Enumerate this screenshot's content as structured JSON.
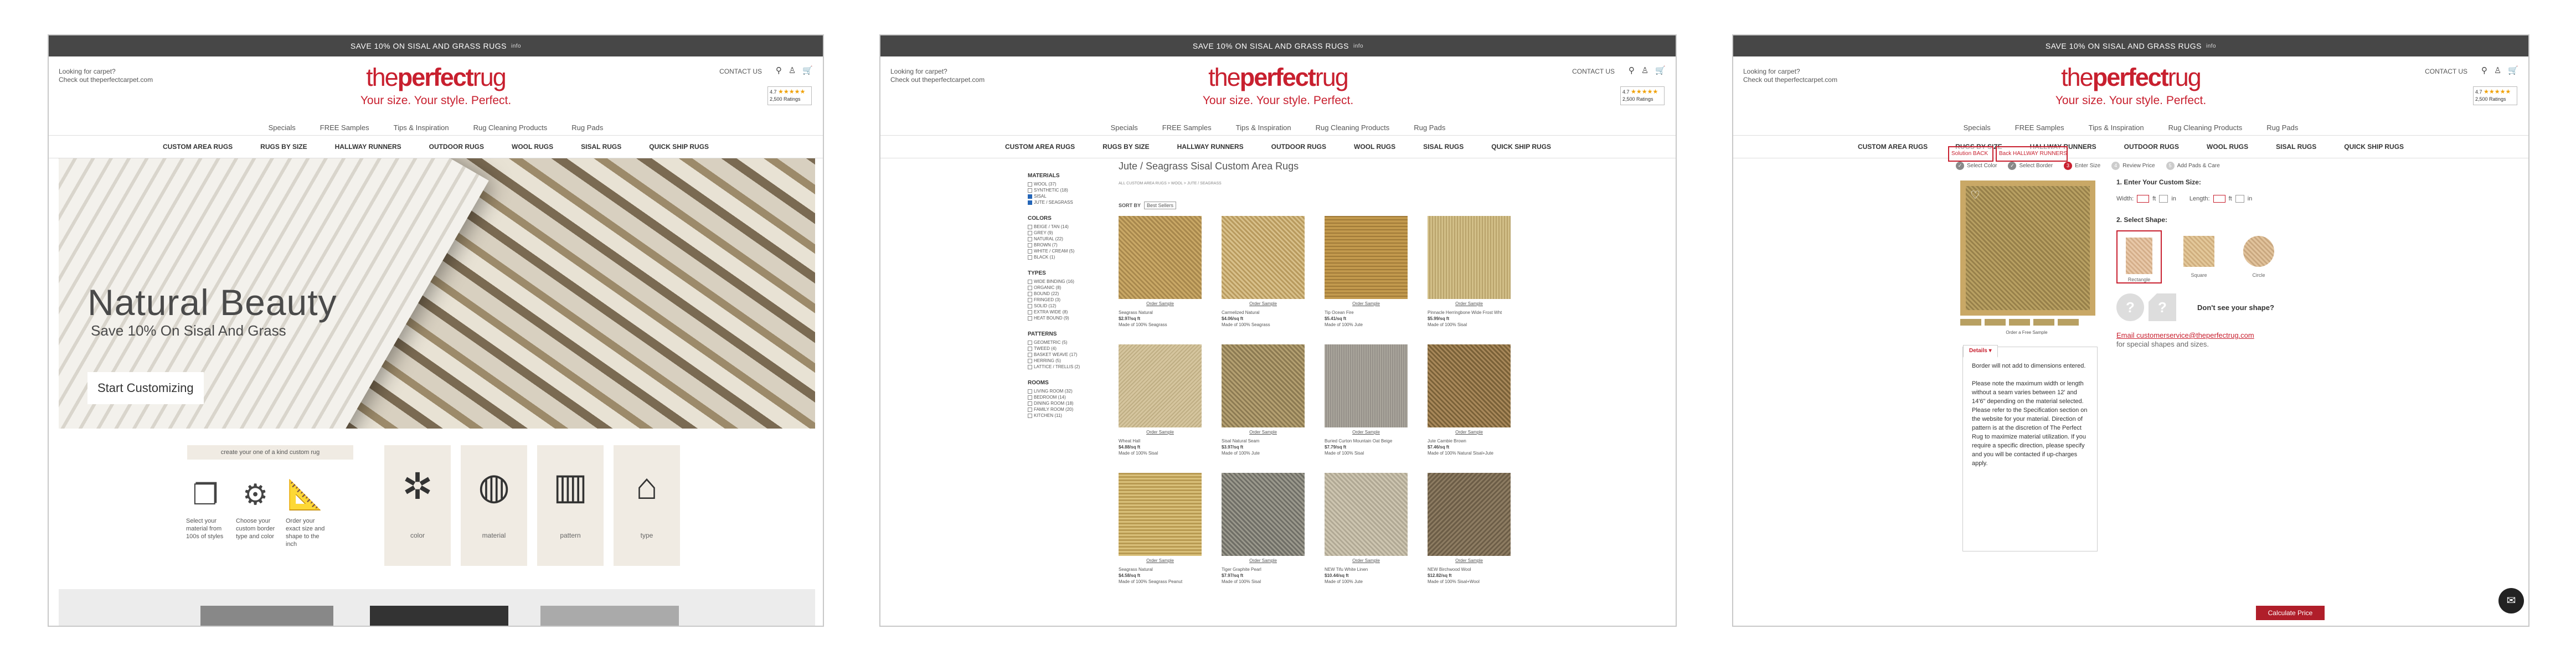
{
  "site": {
    "topbar": "SAVE 10% ON SISAL AND GRASS RUGS",
    "topbar_sub": "info",
    "looking": "Looking for carpet?",
    "checkout": "Check out theperfectcarpet.com",
    "logo_pre": "the",
    "logo_main": "perfect",
    "logo_end": "rug",
    "tagline": "Your size. Your style. Perfect.",
    "contact": "CONTACT US",
    "reviews_stars": "★★★★★",
    "reviews_label": "2,500 Ratings",
    "reviews_score": "4.7",
    "submenu": [
      "Specials",
      "FREE Samples",
      "Tips & Inspiration",
      "Rug Cleaning Products",
      "Rug Pads"
    ],
    "nav": [
      "CUSTOM AREA RUGS",
      "RUGS BY SIZE",
      "HALLWAY RUNNERS",
      "OUTDOOR RUGS",
      "WOOL RUGS",
      "SISAL RUGS",
      "QUICK SHIP RUGS"
    ]
  },
  "home": {
    "hero_title": "Natural Beauty",
    "hero_sub": "Save 10% On Sisal And Grass",
    "hero_btn": "Start Customizing",
    "create": "create your one of a kind custom rug",
    "steps": [
      {
        "icon": "❐",
        "text": "Select your material from 100s of styles"
      },
      {
        "icon": "⚙",
        "text": "Choose your custom border type and color"
      },
      {
        "icon": "📐",
        "text": "Order your exact size and shape to the inch"
      }
    ],
    "tiles": [
      {
        "icon": "✲",
        "label": "color"
      },
      {
        "icon": "◍",
        "label": "material"
      },
      {
        "icon": "▥",
        "label": "pattern"
      },
      {
        "icon": "⌂",
        "label": "type"
      }
    ]
  },
  "listing": {
    "title": "Jute / Seagrass Sisal Custom Area Rugs",
    "breadcrumb": "ALL CUSTOM AREA RUGS > WOOL > JUTE / SEAGRASS",
    "sort_label": "SORT BY",
    "sort_value": "Best Sellers",
    "filters": [
      {
        "name": "MATERIALS",
        "opts": [
          {
            "label": "WOOL (37)",
            "on": false
          },
          {
            "label": "SYNTHETIC (18)",
            "on": false
          },
          {
            "label": "SISAL",
            "on": true
          },
          {
            "label": "JUTE / SEAGRASS",
            "on": true
          }
        ]
      },
      {
        "name": "COLORS",
        "opts": [
          {
            "label": "BEIGE / TAN (14)",
            "on": false
          },
          {
            "label": "GREY (9)",
            "on": false
          },
          {
            "label": "NATURAL (22)",
            "on": false
          },
          {
            "label": "BROWN (7)",
            "on": false
          },
          {
            "label": "WHITE / CREAM (5)",
            "on": false
          },
          {
            "label": "BLACK (1)",
            "on": false
          }
        ]
      },
      {
        "name": "TYPES",
        "opts": [
          {
            "label": "WIDE BINDING (16)",
            "on": false
          },
          {
            "label": "ORGANIC (8)",
            "on": false
          },
          {
            "label": "BOUND (22)",
            "on": false
          },
          {
            "label": "FRINGED (3)",
            "on": false
          },
          {
            "label": "SOLID (12)",
            "on": false
          },
          {
            "label": "EXTRA WIDE (8)",
            "on": false
          },
          {
            "label": "HEAT BOUND (9)",
            "on": false
          }
        ]
      },
      {
        "name": "PATTERNS",
        "opts": [
          {
            "label": "GEOMETRIC (5)",
            "on": false
          },
          {
            "label": "TWEED (4)",
            "on": false
          },
          {
            "label": "BASKET WEAVE (17)",
            "on": false
          },
          {
            "label": "HERRING (5)",
            "on": false
          },
          {
            "label": "LATTICE / TRELLIS (2)",
            "on": false
          }
        ]
      },
      {
        "name": "ROOMS",
        "opts": [
          {
            "label": "LIVING ROOM (32)",
            "on": false
          },
          {
            "label": "BEDROOM (14)",
            "on": false
          },
          {
            "label": "DINING ROOM (18)",
            "on": false
          },
          {
            "label": "FAMILY ROOM (20)",
            "on": false
          },
          {
            "label": "KITCHEN (11)",
            "on": false
          }
        ]
      }
    ],
    "swatch_label": "Order Sample",
    "products": [
      {
        "name": "Seagrass Natural",
        "price": "$2.97/sq ft",
        "mat": "Made of 100% Seagrass"
      },
      {
        "name": "Carmelized Natural",
        "price": "$4.06/sq ft",
        "mat": "Made of 100% Seagrass"
      },
      {
        "name": "Tip Ocean Fire",
        "price": "$5.41/sq ft",
        "mat": "Made of 100% Jute"
      },
      {
        "name": "Pinnacle Herringbone Wide Frost Wht",
        "price": "$5.99/sq ft",
        "mat": "Made of 100% Sisal"
      },
      {
        "name": "Wheat Hall",
        "price": "$4.88/sq ft",
        "mat": "Made of 100% Sisal"
      },
      {
        "name": "Sisal Natural Seam",
        "price": "$3.97/sq ft",
        "mat": "Made of 100% Jute"
      },
      {
        "name": "Buried Curton Mountain Oat Beige",
        "price": "$7.79/sq ft",
        "mat": "Made of 100% Sisal"
      },
      {
        "name": "Jute Cambie Brown",
        "price": "$7.46/sq ft",
        "mat": "Made of 100% Natural Sisal+Jute"
      },
      {
        "name": "Seagrass Natural",
        "price": "$4.58/sq ft",
        "mat": "Made of 100% Seagrass Peanut"
      },
      {
        "name": "Tiger Graphite Pearl",
        "price": "$7.97/sq ft",
        "mat": "Made of 100% Sisal"
      },
      {
        "name": "NEW Tifu White Linen",
        "price": "$10.44/sq ft",
        "mat": "Made of 100% Jute"
      },
      {
        "name": "NEW Birchwood Wool",
        "price": "$12.82/sq ft",
        "mat": "Made of 100% Sisal+Wool"
      }
    ]
  },
  "configurator": {
    "overlay1": "Solution BACK",
    "overlay2": "Back HALLWAY RUNNERS",
    "steps": [
      {
        "n": "✓",
        "label": "Select Color",
        "state": "done"
      },
      {
        "n": "✓",
        "label": "Select Border",
        "state": "done"
      },
      {
        "n": "3",
        "label": "Enter Size",
        "state": "act"
      },
      {
        "n": "4",
        "label": "Review Price",
        "state": "off"
      },
      {
        "n": "5",
        "label": "Add Pads & Care",
        "state": "off"
      }
    ],
    "free_sample": "Order a Free Sample",
    "details_tab": "Details ▾",
    "details": [
      "Border will not add to dimensions entered.",
      "Please note the maximum width or length without a seam varies between 12' and 14'6\" depending on the material selected. Please refer to the Specification section on the website for your material. Direction of pattern is at the discretion of The Perfect Rug to maximize material utilization. If you require a specific direction, please specify and you will be contacted if up-charges apply."
    ],
    "size_heading": "1. Enter Your Custom Size:",
    "width_label": "Width:",
    "length_label": "Length:",
    "ft": "ft",
    "in": "in",
    "shape_heading": "2. Select Shape:",
    "shapes": [
      "Rectangle",
      "Square",
      "Circle"
    ],
    "custom_q": "Don't see your shape?",
    "email": "Email customerservice@theperfectrug.com",
    "email_sub": "for special shapes and sizes.",
    "calc": "Calculate Price",
    "chat": "✉"
  }
}
